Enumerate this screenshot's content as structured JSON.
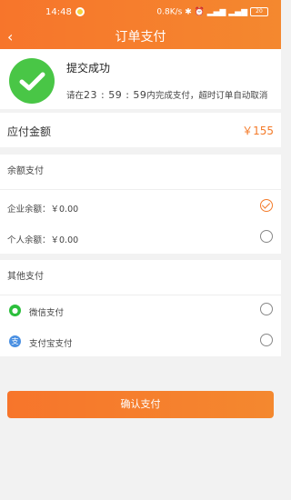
{
  "status_bar": {
    "time": "14:48",
    "network_speed": "0.8K/s",
    "battery": "20"
  },
  "header": {
    "title": "订单支付",
    "back_icon": "chevron-left-icon"
  },
  "order_status": {
    "title": "提交成功",
    "note_prefix": "请在",
    "countdown": "23 : 59 : 59",
    "note_suffix": "内完成支付，超时订单自动取消"
  },
  "amount": {
    "label": "应付金额",
    "value": "￥155"
  },
  "balance_pay": {
    "title": "余额支付",
    "options": [
      {
        "label": "企业余额：￥0.00",
        "selected": true
      },
      {
        "label": "个人余额：￥0.00",
        "selected": false
      }
    ]
  },
  "other_pay": {
    "title": "其他支付",
    "options": [
      {
        "label": "微信支付",
        "icon": "wechat-icon",
        "icon_color": "#2bbf3c",
        "icon_glyph": "●",
        "selected": false
      },
      {
        "label": "支付宝支付",
        "icon": "alipay-icon",
        "icon_color": "#4a90e2",
        "icon_glyph": "支",
        "selected": false
      }
    ]
  },
  "confirm_button": {
    "label": "确认支付"
  },
  "colors": {
    "accent": "#f47b2a",
    "success": "#49c646"
  }
}
